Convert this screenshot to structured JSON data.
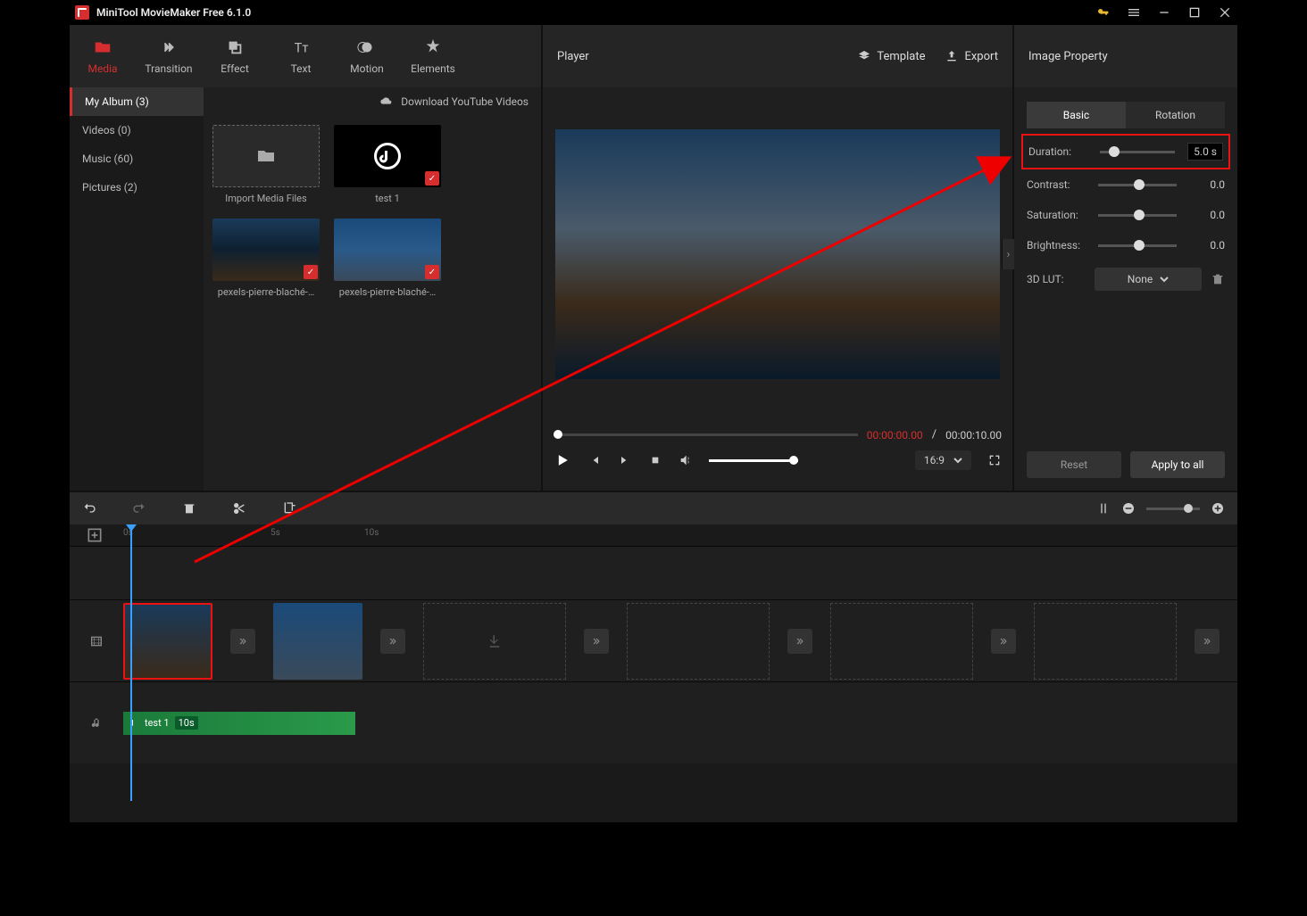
{
  "title": "MiniTool MovieMaker Free 6.1.0",
  "mediaTabs": {
    "media": "Media",
    "transition": "Transition",
    "effect": "Effect",
    "text": "Text",
    "motion": "Motion",
    "elements": "Elements"
  },
  "sidenav": {
    "album": "My Album (3)",
    "videos": "Videos (0)",
    "music": "Music (60)",
    "pictures": "Pictures (2)"
  },
  "download_label": "Download YouTube Videos",
  "media_items": {
    "import": "Import Media Files",
    "test1": "test 1",
    "img1": "pexels-pierre-blaché-…",
    "img2": "pexels-pierre-blaché-…"
  },
  "player": {
    "title": "Player",
    "template": "Template",
    "export": "Export",
    "current": "00:00:00.00",
    "sep": "/",
    "total": "00:00:10.00",
    "aspect": "16:9"
  },
  "props": {
    "title": "Image Property",
    "tab_basic": "Basic",
    "tab_rotation": "Rotation",
    "duration_label": "Duration:",
    "duration_value": "5.0 s",
    "contrast_label": "Contrast:",
    "contrast_value": "0.0",
    "saturation_label": "Saturation:",
    "saturation_value": "0.0",
    "brightness_label": "Brightness:",
    "brightness_value": "0.0",
    "lut_label": "3D LUT:",
    "lut_value": "None",
    "reset": "Reset",
    "apply": "Apply to all"
  },
  "ruler": {
    "t0": "0s",
    "t1": "5s",
    "t2": "10s"
  },
  "audio_clip": {
    "name": "test 1",
    "dur": "10s"
  }
}
